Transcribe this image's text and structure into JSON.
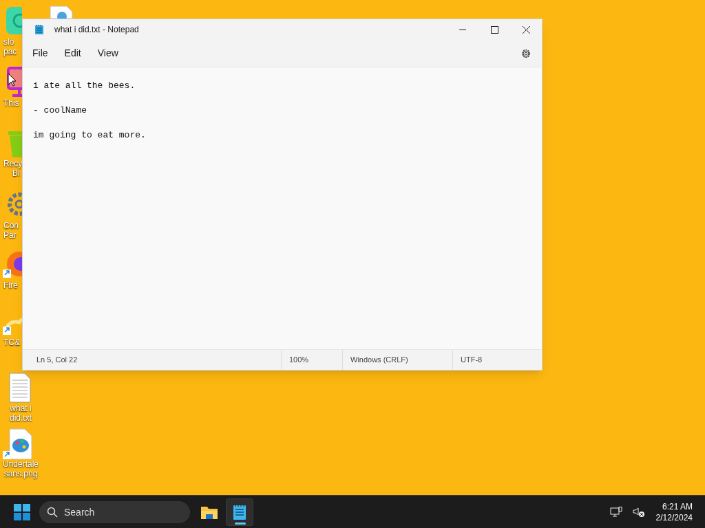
{
  "desktop_icons": [
    {
      "kind": "app",
      "label": [
        "slo",
        "pac"
      ]
    },
    {
      "kind": "monitor",
      "label": [
        "This"
      ]
    },
    {
      "kind": "bin",
      "label": [
        "Recy",
        "Bi"
      ]
    },
    {
      "kind": "gear",
      "label": [
        "Con",
        "Par"
      ]
    },
    {
      "kind": "browser",
      "label": [
        "Fire"
      ]
    },
    {
      "kind": "cloud",
      "label": [
        "TC&"
      ]
    },
    {
      "kind": "textfile",
      "label": [
        "what i",
        "did.txt"
      ]
    },
    {
      "kind": "image",
      "label": [
        "Undertale",
        "sans.png"
      ]
    }
  ],
  "window": {
    "title": "what i did.txt - Notepad",
    "menu": [
      "File",
      "Edit",
      "View"
    ],
    "text": "i ate all the bees.\n\n- coolName\n\nim going to eat more.",
    "status_bar": [
      "Ln 5, Col 22",
      "100%",
      "Windows (CRLF)",
      "UTF-8"
    ]
  },
  "taskbar": {
    "search": {
      "placeholder": "Search"
    },
    "apps": [
      {
        "kind": "folder",
        "selected": false
      },
      {
        "kind": "notepad",
        "selected": true
      }
    ],
    "time": "6:21 AM",
    "date": "2/12/2024"
  }
}
